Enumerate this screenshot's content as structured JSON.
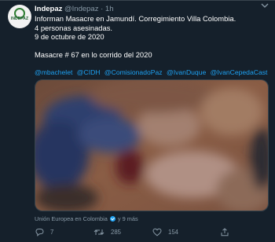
{
  "tweet": {
    "avatar_text": "INDEPAZ",
    "display_name": "Indepaz",
    "handle": "@Indepaz",
    "separator": "·",
    "time": "1h",
    "lines": [
      "Informan Masacre en Jamundí. Corregimiento Villa Colombia.",
      "4 personas asesinadas.",
      "9 de octubre de 2020",
      "",
      "Masacre # 67 en lo corrido del 2020"
    ],
    "mentions": [
      "@mbachelet",
      "@CIDH",
      "@ComisionadoPaz",
      "@IvanDuque",
      "@IvanCepedaCast"
    ],
    "media_alt": "",
    "credit": {
      "name": "Unión Europea en Colombia",
      "rest": "y 9 más"
    },
    "actions": {
      "reply_count": "7",
      "retweet_count": "285",
      "like_count": "154"
    }
  },
  "colors": {
    "background": "#15202b",
    "link": "#1da1f2",
    "secondary_text": "#8899a6",
    "border": "#38444d"
  },
  "icons": {
    "more": "chevron-down-icon",
    "reply": "reply-icon",
    "retweet": "retweet-icon",
    "like": "heart-icon",
    "share": "share-icon"
  }
}
